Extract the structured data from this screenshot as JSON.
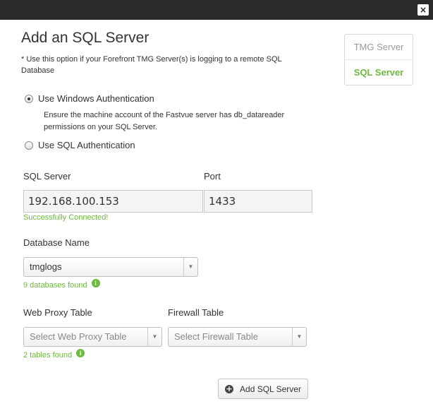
{
  "window": {
    "close_glyph": "×"
  },
  "dialog": {
    "title": "Add an SQL Server",
    "note": "* Use this option if your Forefront TMG Server(s) is logging to a remote SQL Database"
  },
  "side_tabs": [
    {
      "label": "TMG Server",
      "active": false
    },
    {
      "label": "SQL Server",
      "active": true
    }
  ],
  "auth": {
    "windows_label": "Use Windows Authentication",
    "windows_selected": true,
    "windows_desc": "Ensure the machine account of the Fastvue server has db_datareader permissions on your SQL Server.",
    "sql_label": "Use SQL Authentication",
    "sql_selected": false
  },
  "connection": {
    "server_label": "SQL Server",
    "server_value": "192.168.100.153",
    "port_label": "Port",
    "port_value": "1433",
    "status": "Successfully Connected!"
  },
  "database": {
    "label": "Database Name",
    "selected": "tmglogs",
    "found": "9 databases found"
  },
  "tables": {
    "web_proxy_label": "Web Proxy Table",
    "web_proxy_placeholder": "Select Web Proxy Table",
    "firewall_label": "Firewall Table",
    "firewall_placeholder": "Select Firewall Table",
    "found": "2 tables found"
  },
  "actions": {
    "add_label": "Add SQL Server"
  },
  "colors": {
    "accent_green": "#6dba3f",
    "topbar": "#2b2b2b"
  },
  "icons": {
    "info": "info-icon",
    "plus": "plus-circle-icon",
    "caret": "chevron-down-icon",
    "close": "close-icon"
  }
}
